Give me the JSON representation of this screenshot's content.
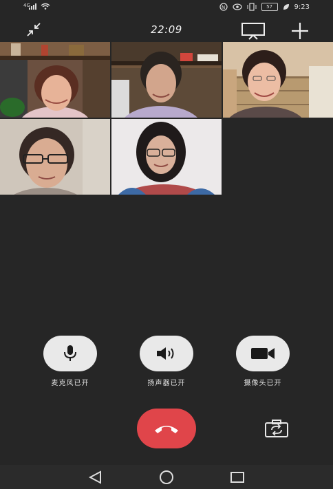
{
  "status_bar": {
    "network_type": "4G",
    "battery": "57",
    "time": "9:23"
  },
  "call": {
    "duration": "22:09"
  },
  "participants": [
    {
      "name": "participant-1"
    },
    {
      "name": "participant-2"
    },
    {
      "name": "participant-3"
    },
    {
      "name": "participant-4"
    },
    {
      "name": "participant-5"
    }
  ],
  "controls": {
    "microphone_label": "麦克风已开",
    "speaker_label": "扬声器已开",
    "camera_label": "摄像头已开"
  },
  "icons": {
    "minimize": "minimize-icon",
    "screen_share": "screen-share-icon",
    "add_member": "add-member-icon",
    "microphone": "microphone-icon",
    "speaker": "speaker-icon",
    "camera": "video-camera-icon",
    "hangup": "hangup-icon",
    "switch_camera": "switch-camera-icon"
  },
  "colors": {
    "background": "#262626",
    "control_button": "#e9e9e9",
    "hangup": "#e0454a"
  }
}
